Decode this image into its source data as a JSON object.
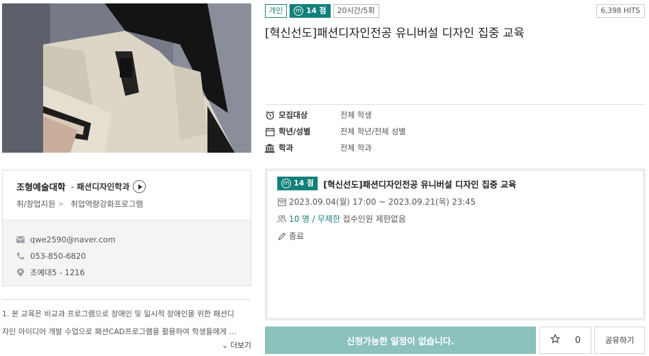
{
  "program": {
    "badges": {
      "type": "개인",
      "points": "14 점",
      "duration": "20시간/5회"
    },
    "mileage_icon": "ⓜ",
    "hits": "6,398 HITS",
    "title": "[혁신선도]패션디자인전공 유니버설 디자인 집중 교육",
    "info": [
      {
        "icon": "alarm-clock-icon",
        "label": "모집대상",
        "value": "전체 학생"
      },
      {
        "icon": "calendar-icon",
        "label": "학년/성별",
        "value": "전체 학년/전체 성별"
      },
      {
        "icon": "building-icon",
        "label": "학과",
        "value": "전체 학과"
      }
    ]
  },
  "department": {
    "college": "조형예술대학",
    "separator": "-",
    "name": "패션디자인학과",
    "category": "취/창업지원",
    "category_arrow": ">",
    "subcategory": "취업역량강화프로그램",
    "email": "qwe2590@naver.com",
    "phone": "053-850-6820",
    "location": "조예대5 - 1216"
  },
  "description": {
    "line1": "1. 본 교육은 비교과 프로그램으로 장애인 및 일시적 장애인을 위한 패션디",
    "line2": "자인 아이디어 개발 수업으로 패션CAD프로그램을 활용하여 학생들에게 …",
    "more": "더보기"
  },
  "schedule": {
    "points": "14 점",
    "title": "[혁신선도]패션디자인전공 유니버설 디자인 집중 교육",
    "period": "2023.09.04(월) 17:00 ~ 2023.09.21(목) 23:45",
    "capacity_teal": "10 명 / 무제한",
    "capacity_rest": "접수인원 제한없음",
    "status": "종료"
  },
  "actions": {
    "apply": "신청가능한 일정이 없습니다.",
    "favorite_count": "0",
    "share": "공유하기"
  },
  "colors": {
    "accent": "#12807a",
    "apply_bg": "#8cc2bd"
  }
}
